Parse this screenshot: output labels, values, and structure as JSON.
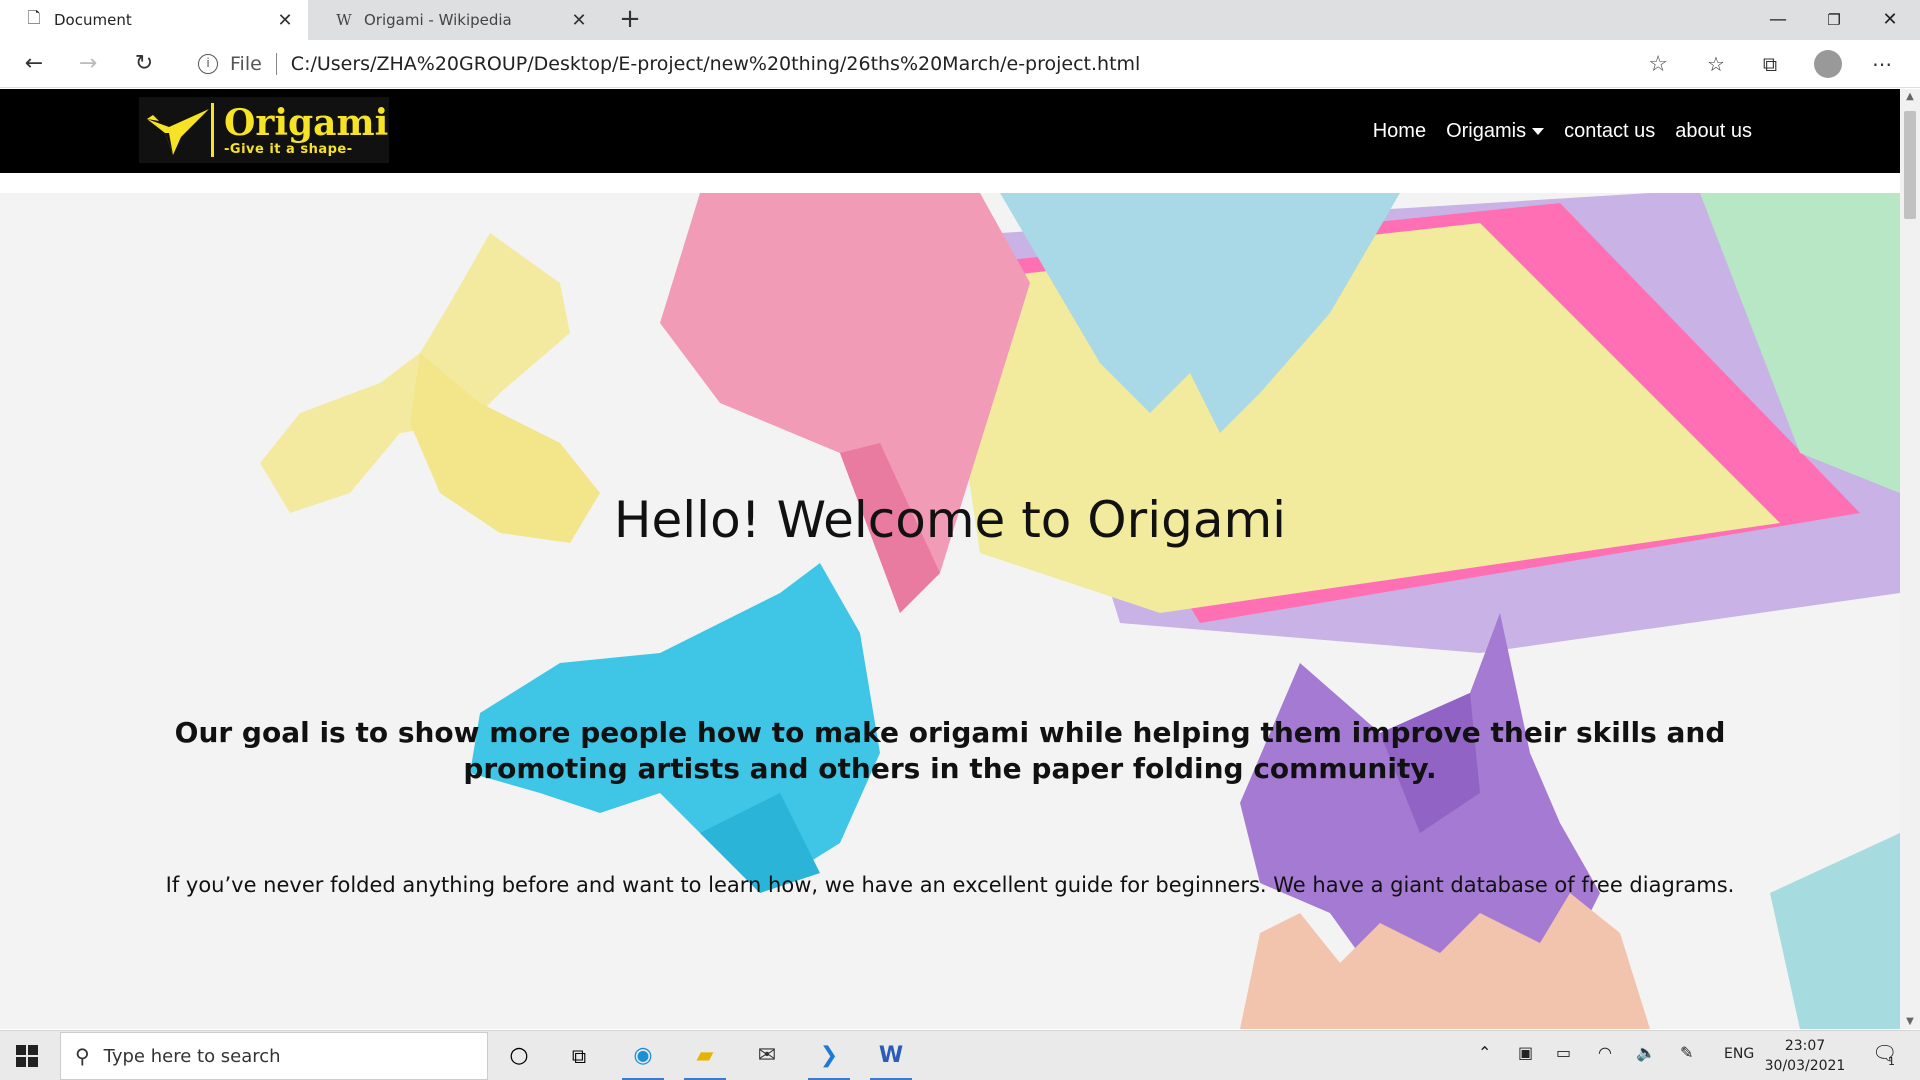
{
  "browser": {
    "tabs": [
      {
        "label": "Document",
        "icon": "page-icon",
        "active": true
      },
      {
        "label": "Origami - Wikipedia",
        "icon": "wikipedia-icon",
        "active": false
      }
    ],
    "address": {
      "info_label": "File",
      "url": "C:/Users/ZHA%20GROUP/Desktop/E-project/new%20thing/26ths%20March/e-project.html"
    }
  },
  "site": {
    "logo": {
      "name": "Origami",
      "tagline": "-Give it a shape-"
    },
    "nav": {
      "home": "Home",
      "origamis": "Origamis",
      "contact": "contact us",
      "about": "about us"
    },
    "hero": {
      "title": "Hello! Welcome to Origami",
      "goal": "Our goal is to show more people how to make origami while helping them improve their skills and promoting artists and others in the paper folding community.",
      "subtext": "If you’ve never folded anything before and want to learn how, we have an excellent guide for beginners. We have a giant database of free diagrams."
    }
  },
  "taskbar": {
    "search_placeholder": "Type here to search",
    "language": "ENG",
    "time": "23:07",
    "date": "30/03/2021",
    "notification_count": "1"
  }
}
